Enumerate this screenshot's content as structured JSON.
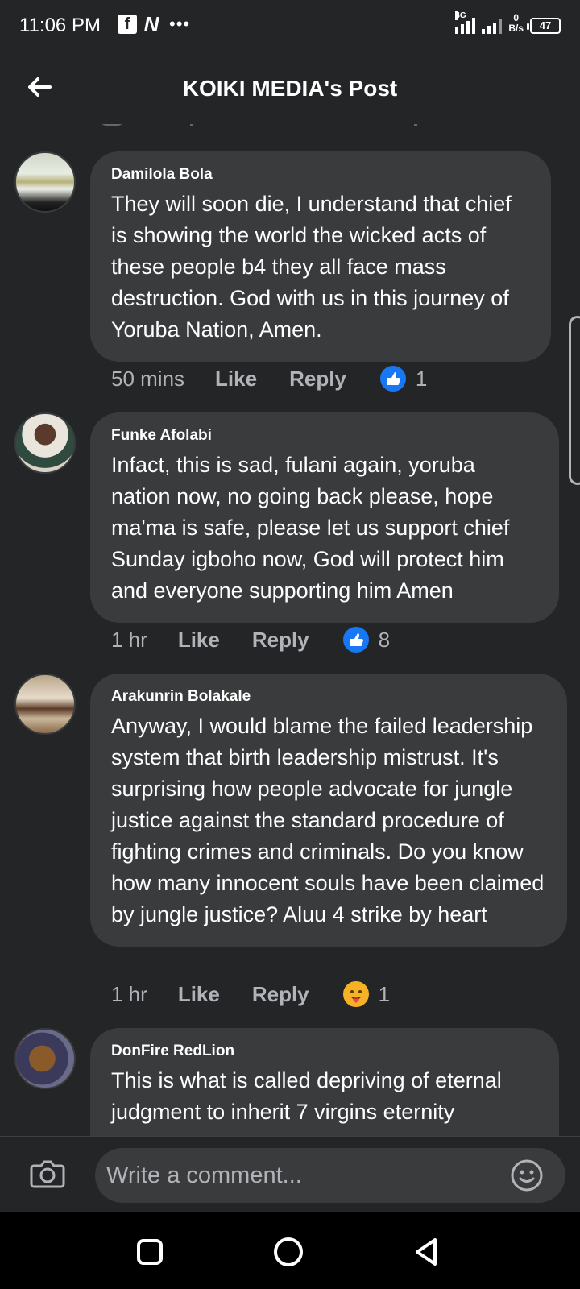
{
  "status_bar": {
    "time": "11:06 PM",
    "apps": [
      "facebook-icon",
      "n-app-icon",
      "more-dots-icon"
    ],
    "network_type": "4G",
    "net_speed_value": "0",
    "net_speed_unit": "B/s",
    "battery": "47"
  },
  "header": {
    "title": "KOIKI MEDIA's Post",
    "back_icon": "arrow-left-icon"
  },
  "comments": [
    {
      "author": "Damilola Bola",
      "text": "They will soon die, I understand that chief is showing the world the wicked acts of these people b4 they all face mass destruction. God with us in this journey of Yoruba Nation, Amen.",
      "time": "50 mins",
      "like_label": "Like",
      "reply_label": "Reply",
      "reaction": "like",
      "reaction_count": "1"
    },
    {
      "author": "Funke Afolabi",
      "text": "Infact, this is sad, fulani again, yoruba nation now, no going back please, hope ma'ma is safe, please let us support chief Sunday igboho now, God will protect him and everyone supporting him Amen",
      "time": "1 hr",
      "like_label": "Like",
      "reply_label": "Reply",
      "reaction": "like",
      "reaction_count": "8"
    },
    {
      "author": "Arakunrin Bolakale",
      "text": "Anyway, I would blame the failed leadership system that birth leadership mistrust. It's surprising how people advocate for jungle justice against the standard procedure of fighting crimes and criminals. Do you know how many innocent souls have been claimed by jungle justice? Aluu 4 strike by heart",
      "time": "1 hr",
      "like_label": "Like",
      "reply_label": "Reply",
      "reaction": "care",
      "reaction_count": "1"
    },
    {
      "author": "DonFire RedLion",
      "text": "This is what is called depriving of  eternal judgment to inherit 7 virgins eternity",
      "time": "",
      "like_label": "",
      "reply_label": "",
      "reaction": "",
      "reaction_count": ""
    }
  ],
  "composer": {
    "placeholder": "Write a comment...",
    "camera_icon": "camera-icon",
    "emoji_icon": "emoji-icon"
  },
  "nav_bar": {
    "buttons": [
      "recents-square-icon",
      "home-circle-icon",
      "back-triangle-icon"
    ]
  },
  "colors": {
    "background": "#242526",
    "bubble": "#3a3b3c",
    "text_primary": "#ffffff",
    "text_secondary": "#b0b3b8",
    "like_blue": "#1877f2",
    "care_yellow": "#f7b125"
  }
}
